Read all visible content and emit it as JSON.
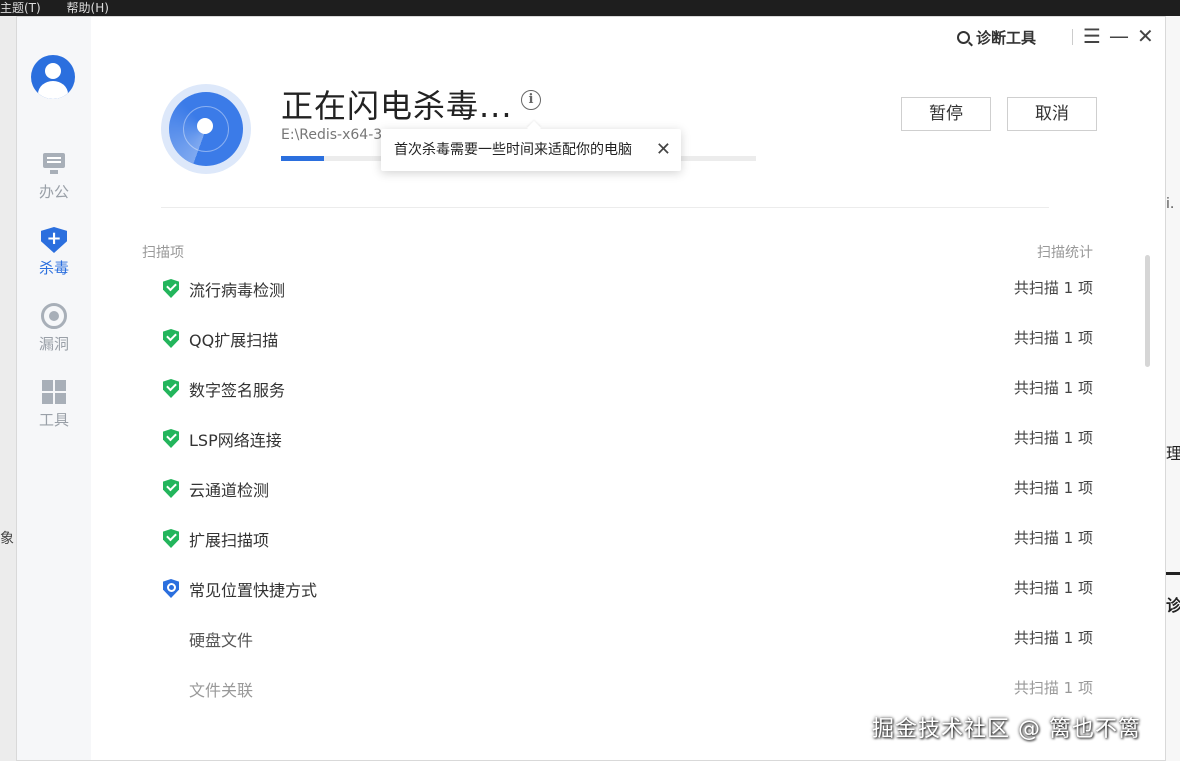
{
  "background": {
    "menu": [
      "主题(T)",
      "帮助(H)"
    ],
    "left_text": "象",
    "right_texts": [
      "i.",
      "理",
      "诊"
    ]
  },
  "sidebar": {
    "items": [
      {
        "label": "办公",
        "icon": "monitor-icon",
        "active": false
      },
      {
        "label": "杀毒",
        "icon": "shield-icon",
        "active": true
      },
      {
        "label": "漏洞",
        "icon": "vulnerability-icon",
        "active": false
      },
      {
        "label": "工具",
        "icon": "tools-grid-icon",
        "active": false
      }
    ]
  },
  "titlebar": {
    "diagnose_label": "诊断工具",
    "menu_glyph": "☰",
    "minimize_glyph": "—",
    "close_glyph": "✕"
  },
  "scan": {
    "title": "正在闪电杀毒...",
    "info_glyph": "i",
    "path": "E:\\Redis-x64-3",
    "progress_percent": 9,
    "tooltip": "首次杀毒需要一些时间来适配你的电脑",
    "tooltip_close": "✕",
    "pause_label": "暂停",
    "cancel_label": "取消"
  },
  "list": {
    "col_item": "扫描项",
    "col_stats": "扫描统计",
    "rows": [
      {
        "name": "流行病毒检测",
        "stat": "共扫描 1 项",
        "status": "done"
      },
      {
        "name": "QQ扩展扫描",
        "stat": "共扫描 1 项",
        "status": "done"
      },
      {
        "name": "数字签名服务",
        "stat": "共扫描 1 项",
        "status": "done"
      },
      {
        "name": "LSP网络连接",
        "stat": "共扫描 1 项",
        "status": "done"
      },
      {
        "name": "云通道检测",
        "stat": "共扫描 1 项",
        "status": "done"
      },
      {
        "name": "扩展扫描项",
        "stat": "共扫描 1 项",
        "status": "done"
      },
      {
        "name": "常见位置快捷方式",
        "stat": "共扫描 1 项",
        "status": "scanning"
      },
      {
        "name": "硬盘文件",
        "stat": "共扫描 1 项",
        "status": "sub"
      },
      {
        "name": "文件关联",
        "stat": "共扫描 1 项",
        "status": "faded"
      }
    ]
  },
  "watermark": "掘金技术社区 @ 篱也不篱",
  "colors": {
    "accent": "#2b6fde",
    "success": "#23b55c"
  }
}
